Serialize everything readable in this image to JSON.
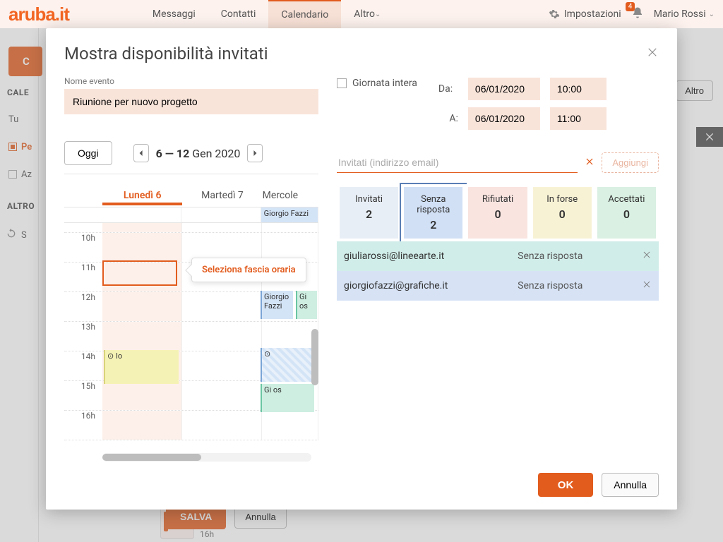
{
  "topnav": {
    "logo": "aruba.it",
    "tabs": [
      "Messaggi",
      "Contatti",
      "Calendario",
      "Altro"
    ],
    "active_tab": 2,
    "settings_label": "Impostazioni",
    "badge": "4",
    "user": "Mario Rossi"
  },
  "sidebar": {
    "create": "C",
    "section1": "CALE",
    "items1": [
      "Tu",
      "Pe",
      "Az"
    ],
    "section2": "ALTRO",
    "sync_label": "S"
  },
  "bg": {
    "btn_altro": "Altro",
    "save": "SALVA",
    "cancel": "Annulla",
    "hour_marker": "16h"
  },
  "modal": {
    "title": "Mostra disponibilità invitati",
    "name_label": "Nome evento",
    "name_value": "Riunione per nuovo progetto",
    "allday_label": "Giornata intera",
    "from_label": "Da:",
    "to_label": "A:",
    "from_date": "06/01/2020",
    "from_time": "10:00",
    "to_date": "06/01/2020",
    "to_time": "11:00",
    "today_btn": "Oggi",
    "range_bold": "6 — 12",
    "range_rest": " Gen 2020",
    "days": [
      "Lunedì 6",
      "Martedì 7",
      "Mercole"
    ],
    "allday_event": "Giorgio Fazzi",
    "hours": [
      "10h",
      "11h",
      "12h",
      "13h",
      "14h",
      "15h",
      "16h"
    ],
    "tooltip": "Seleziona fascia oraria",
    "ev_io": "⊙ Io",
    "ev_gf": "Giorgio Fazzi",
    "ev_gi": "Gi",
    "ev_gi2": "Gi os",
    "ev_os": "os",
    "invite_placeholder": "Invitati (indirizzo email)",
    "add_btn": "Aggiungi",
    "status_cols": [
      {
        "label": "Invitati",
        "count": "2"
      },
      {
        "label": "Senza risposta",
        "count": "2"
      },
      {
        "label": "Rifiutati",
        "count": "0"
      },
      {
        "label": "In forse",
        "count": "0"
      },
      {
        "label": "Accettati",
        "count": "0"
      }
    ],
    "invitees": [
      {
        "email": "giuliarossi@lineearte.it",
        "status": "Senza risposta"
      },
      {
        "email": "giorgiofazzi@grafiche.it",
        "status": "Senza risposta"
      }
    ],
    "ok": "OK",
    "cancel": "Annulla"
  }
}
